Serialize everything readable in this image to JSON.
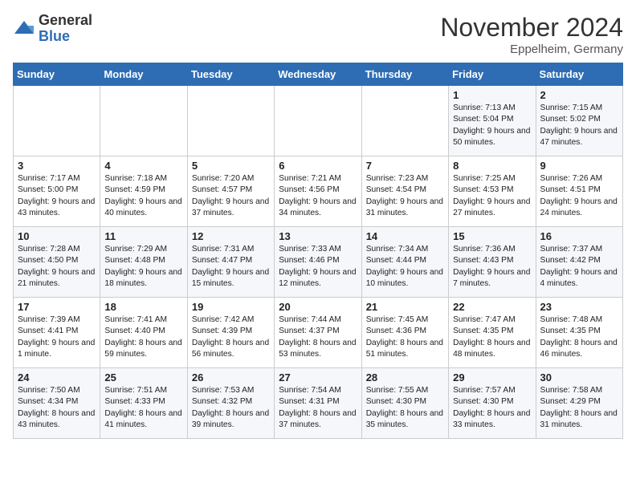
{
  "logo": {
    "general": "General",
    "blue": "Blue"
  },
  "title": "November 2024",
  "location": "Eppelheim, Germany",
  "days_of_week": [
    "Sunday",
    "Monday",
    "Tuesday",
    "Wednesday",
    "Thursday",
    "Friday",
    "Saturday"
  ],
  "weeks": [
    [
      {
        "day": "",
        "info": ""
      },
      {
        "day": "",
        "info": ""
      },
      {
        "day": "",
        "info": ""
      },
      {
        "day": "",
        "info": ""
      },
      {
        "day": "",
        "info": ""
      },
      {
        "day": "1",
        "info": "Sunrise: 7:13 AM\nSunset: 5:04 PM\nDaylight: 9 hours and 50 minutes."
      },
      {
        "day": "2",
        "info": "Sunrise: 7:15 AM\nSunset: 5:02 PM\nDaylight: 9 hours and 47 minutes."
      }
    ],
    [
      {
        "day": "3",
        "info": "Sunrise: 7:17 AM\nSunset: 5:00 PM\nDaylight: 9 hours and 43 minutes."
      },
      {
        "day": "4",
        "info": "Sunrise: 7:18 AM\nSunset: 4:59 PM\nDaylight: 9 hours and 40 minutes."
      },
      {
        "day": "5",
        "info": "Sunrise: 7:20 AM\nSunset: 4:57 PM\nDaylight: 9 hours and 37 minutes."
      },
      {
        "day": "6",
        "info": "Sunrise: 7:21 AM\nSunset: 4:56 PM\nDaylight: 9 hours and 34 minutes."
      },
      {
        "day": "7",
        "info": "Sunrise: 7:23 AM\nSunset: 4:54 PM\nDaylight: 9 hours and 31 minutes."
      },
      {
        "day": "8",
        "info": "Sunrise: 7:25 AM\nSunset: 4:53 PM\nDaylight: 9 hours and 27 minutes."
      },
      {
        "day": "9",
        "info": "Sunrise: 7:26 AM\nSunset: 4:51 PM\nDaylight: 9 hours and 24 minutes."
      }
    ],
    [
      {
        "day": "10",
        "info": "Sunrise: 7:28 AM\nSunset: 4:50 PM\nDaylight: 9 hours and 21 minutes."
      },
      {
        "day": "11",
        "info": "Sunrise: 7:29 AM\nSunset: 4:48 PM\nDaylight: 9 hours and 18 minutes."
      },
      {
        "day": "12",
        "info": "Sunrise: 7:31 AM\nSunset: 4:47 PM\nDaylight: 9 hours and 15 minutes."
      },
      {
        "day": "13",
        "info": "Sunrise: 7:33 AM\nSunset: 4:46 PM\nDaylight: 9 hours and 12 minutes."
      },
      {
        "day": "14",
        "info": "Sunrise: 7:34 AM\nSunset: 4:44 PM\nDaylight: 9 hours and 10 minutes."
      },
      {
        "day": "15",
        "info": "Sunrise: 7:36 AM\nSunset: 4:43 PM\nDaylight: 9 hours and 7 minutes."
      },
      {
        "day": "16",
        "info": "Sunrise: 7:37 AM\nSunset: 4:42 PM\nDaylight: 9 hours and 4 minutes."
      }
    ],
    [
      {
        "day": "17",
        "info": "Sunrise: 7:39 AM\nSunset: 4:41 PM\nDaylight: 9 hours and 1 minute."
      },
      {
        "day": "18",
        "info": "Sunrise: 7:41 AM\nSunset: 4:40 PM\nDaylight: 8 hours and 59 minutes."
      },
      {
        "day": "19",
        "info": "Sunrise: 7:42 AM\nSunset: 4:39 PM\nDaylight: 8 hours and 56 minutes."
      },
      {
        "day": "20",
        "info": "Sunrise: 7:44 AM\nSunset: 4:37 PM\nDaylight: 8 hours and 53 minutes."
      },
      {
        "day": "21",
        "info": "Sunrise: 7:45 AM\nSunset: 4:36 PM\nDaylight: 8 hours and 51 minutes."
      },
      {
        "day": "22",
        "info": "Sunrise: 7:47 AM\nSunset: 4:35 PM\nDaylight: 8 hours and 48 minutes."
      },
      {
        "day": "23",
        "info": "Sunrise: 7:48 AM\nSunset: 4:35 PM\nDaylight: 8 hours and 46 minutes."
      }
    ],
    [
      {
        "day": "24",
        "info": "Sunrise: 7:50 AM\nSunset: 4:34 PM\nDaylight: 8 hours and 43 minutes."
      },
      {
        "day": "25",
        "info": "Sunrise: 7:51 AM\nSunset: 4:33 PM\nDaylight: 8 hours and 41 minutes."
      },
      {
        "day": "26",
        "info": "Sunrise: 7:53 AM\nSunset: 4:32 PM\nDaylight: 8 hours and 39 minutes."
      },
      {
        "day": "27",
        "info": "Sunrise: 7:54 AM\nSunset: 4:31 PM\nDaylight: 8 hours and 37 minutes."
      },
      {
        "day": "28",
        "info": "Sunrise: 7:55 AM\nSunset: 4:30 PM\nDaylight: 8 hours and 35 minutes."
      },
      {
        "day": "29",
        "info": "Sunrise: 7:57 AM\nSunset: 4:30 PM\nDaylight: 8 hours and 33 minutes."
      },
      {
        "day": "30",
        "info": "Sunrise: 7:58 AM\nSunset: 4:29 PM\nDaylight: 8 hours and 31 minutes."
      }
    ]
  ]
}
